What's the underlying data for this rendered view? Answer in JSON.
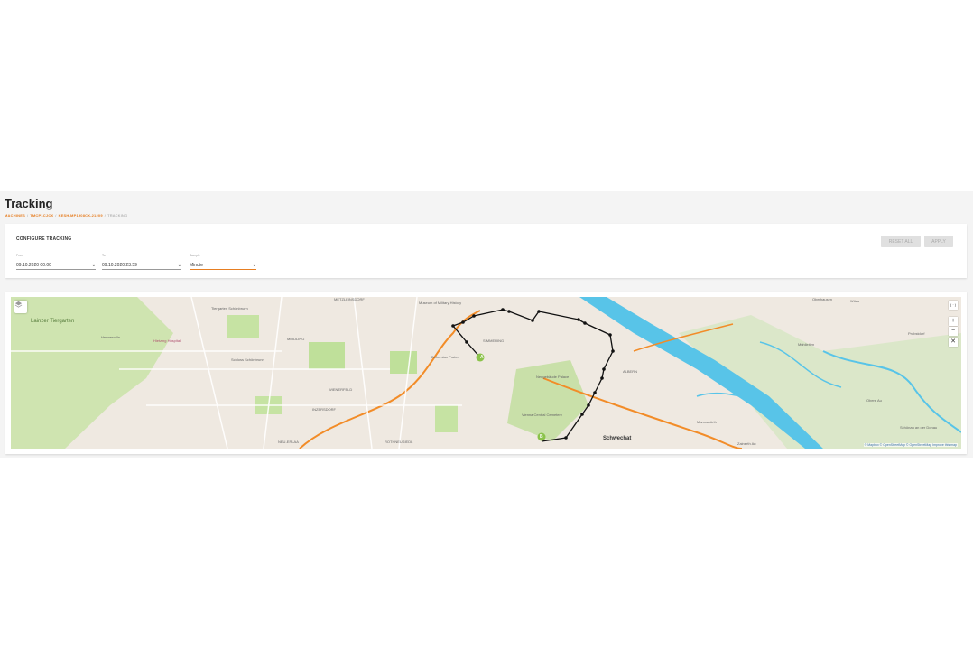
{
  "page": {
    "title": "Tracking",
    "breadcrumb": [
      "MACHINES",
      "TMCP1CJCX",
      "KESH-MP1908CX-21209",
      "TRACKING"
    ]
  },
  "config": {
    "title": "CONFIGURE TRACKING",
    "reset_label": "RESET ALL",
    "apply_label": "APPLY",
    "from": {
      "label": "From",
      "value": "09.10.2020 00:00"
    },
    "to": {
      "label": "To",
      "value": "09.10.2020 23:59"
    },
    "sample": {
      "label": "Sample",
      "value": "Minute"
    }
  },
  "map": {
    "labels": {
      "lainzer": "Lainzer Tiergarten",
      "hermesvilla": "Hermesvilla",
      "hietzing": "Hietzing Hospital",
      "tiergarten": "Tiergarten Schönbrunn",
      "schoenbrunn": "Schloss Schönbrunn",
      "meidling": "MEIDLING",
      "metzleinsdorf": "METZLEINSDORF",
      "military": "Museum of Military History",
      "simmering": "SIMMERING",
      "bohemian": "Bohemian Prater",
      "wienerfeld": "WIENERFELD",
      "inzersdorf": "INZERSDORF",
      "neusiedlung": "Neusiedl",
      "cemetery": "Vienna Central Cemetery",
      "neugebaeude": "Neugebäude Palace",
      "schwechat": "Schwechat",
      "albern": "ALBERN",
      "oberhausen": "Oberhausen",
      "witau": "Witau",
      "muehlleiten": "Mühlleiten",
      "probstdorf": "Probstdorf",
      "mannswoerth": "Mannswörth",
      "oberea": "Obere Au",
      "schoenau": "Schönau an der Donau",
      "zainerth": "Zainerth Au",
      "neu_erlaa": "NEU-ERLAA",
      "rothneusiedl": "ROTHNEUSIEDL",
      "marker_a": "A",
      "marker_b": "B"
    },
    "attribution": "© Mapbox © OpenStreetMap © OpenStreetMap Improve this map",
    "zoom_in": "+",
    "zoom_out": "−",
    "fullscreen": "( · )",
    "colors": {
      "route": "#111111",
      "marker": "#8bc34a",
      "highway": "#f28c28",
      "water": "#58c4e8",
      "park": "#cfe4b0"
    }
  }
}
